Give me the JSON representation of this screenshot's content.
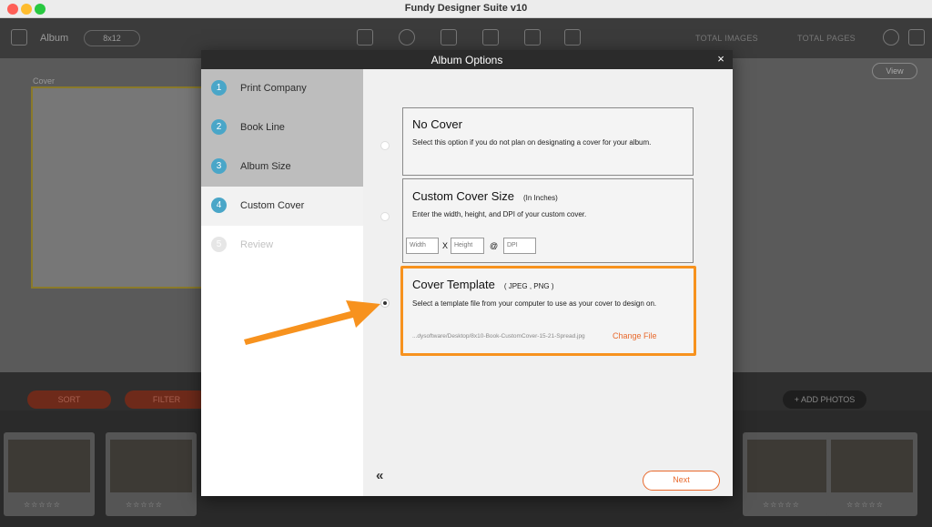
{
  "window": {
    "title": "Fundy Designer Suite v10"
  },
  "app": {
    "album_label": "Album",
    "album_size": "8x12",
    "total_images_label": "TOTAL IMAGES",
    "total_pages_label": "TOTAL PAGES",
    "cover_label": "Cover",
    "view_label": "View",
    "sort_label": "SORT",
    "filter_label": "FILTER",
    "add_photos_label": "+ ADD PHOTOS",
    "rating_stars": "☆☆☆☆☆"
  },
  "modal": {
    "title": "Album Options",
    "close_glyph": "×",
    "steps": [
      {
        "num": "1",
        "label": "Print Company",
        "state": "done"
      },
      {
        "num": "2",
        "label": "Book Line",
        "state": "done"
      },
      {
        "num": "3",
        "label": "Album Size",
        "state": "done"
      },
      {
        "num": "4",
        "label": "Custom Cover",
        "state": "active"
      },
      {
        "num": "5",
        "label": "Review",
        "state": "pending"
      }
    ],
    "options": {
      "no_cover": {
        "title": "No Cover",
        "description": "Select this option if you do not plan on designating a cover for your album."
      },
      "custom_size": {
        "title": "Custom Cover Size",
        "subtitle": "(In Inches)",
        "description": "Enter the width, height, and DPI of your custom cover.",
        "width_placeholder": "Width",
        "height_placeholder": "Height",
        "dpi_placeholder": "DPI",
        "times": "X",
        "at": "@"
      },
      "template": {
        "title": "Cover Template",
        "subtitle": "( JPEG , PNG )",
        "description": "Select a template file from your computer to use as your cover to design on.",
        "file_path": "...dysoftware/Desktop/8x10-Book-CustomCover-15-21-Spread.jpg",
        "change_file": "Change File"
      }
    },
    "selected_option": "template",
    "back_glyph": "«",
    "next_label": "Next"
  },
  "colors": {
    "accent_orange": "#f7921e",
    "link_orange": "#e8692c",
    "step_blue": "#4aa6c8"
  }
}
